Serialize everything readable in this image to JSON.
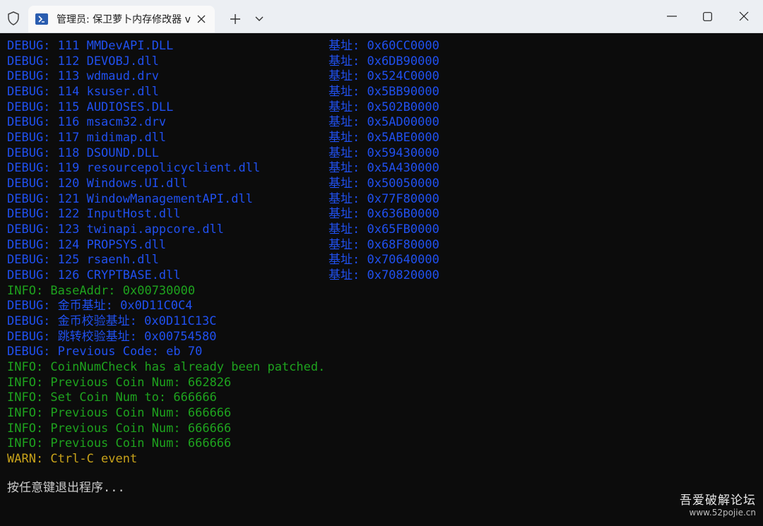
{
  "window": {
    "tab_title": "管理员: 保卫萝卜内存修改器 v",
    "new_tab_symbol": "+",
    "icons": [
      "shield-icon",
      "powershell-icon",
      "close-icon",
      "plus-icon",
      "chevron-down-icon",
      "minimize-icon",
      "maximize-icon",
      "close-window-icon"
    ]
  },
  "colors": {
    "debug": "#2050ef",
    "info": "#1ea31e",
    "warn": "#c7a21a",
    "prompt": "#cccccc",
    "background": "#0c0c0c"
  },
  "modules": [
    {
      "text": "DEBUG: 111 MMDevAPI.DLL",
      "addr": "基址: 0x60CC0000"
    },
    {
      "text": "DEBUG: 112 DEVOBJ.dll",
      "addr": "基址: 0x6DB90000"
    },
    {
      "text": "DEBUG: 113 wdmaud.drv",
      "addr": "基址: 0x524C0000"
    },
    {
      "text": "DEBUG: 114 ksuser.dll",
      "addr": "基址: 0x5BB90000"
    },
    {
      "text": "DEBUG: 115 AUDIOSES.DLL",
      "addr": "基址: 0x502B0000"
    },
    {
      "text": "DEBUG: 116 msacm32.drv",
      "addr": "基址: 0x5AD00000"
    },
    {
      "text": "DEBUG: 117 midimap.dll",
      "addr": "基址: 0x5ABE0000"
    },
    {
      "text": "DEBUG: 118 DSOUND.DLL",
      "addr": "基址: 0x59430000"
    },
    {
      "text": "DEBUG: 119 resourcepolicyclient.dll",
      "addr": "基址: 0x5A430000"
    },
    {
      "text": "DEBUG: 120 Windows.UI.dll",
      "addr": "基址: 0x50050000"
    },
    {
      "text": "DEBUG: 121 WindowManagementAPI.dll",
      "addr": "基址: 0x77F80000"
    },
    {
      "text": "DEBUG: 122 InputHost.dll",
      "addr": "基址: 0x636B0000"
    },
    {
      "text": "DEBUG: 123 twinapi.appcore.dll",
      "addr": "基址: 0x65FB0000"
    },
    {
      "text": "DEBUG: 124 PROPSYS.dll",
      "addr": "基址: 0x68F80000"
    },
    {
      "text": "DEBUG: 125 rsaenh.dll",
      "addr": "基址: 0x70640000"
    },
    {
      "text": "DEBUG: 126 CRYPTBASE.dll",
      "addr": "基址: 0x70820000"
    }
  ],
  "log": [
    {
      "level": "info",
      "text": "INFO: BaseAddr: 0x00730000"
    },
    {
      "level": "debug",
      "text": "DEBUG: 金币基址: 0x0D11C0C4"
    },
    {
      "level": "debug",
      "text": "DEBUG: 金币校验基址: 0x0D11C13C"
    },
    {
      "level": "debug",
      "text": "DEBUG: 跳转校验基址: 0x00754580"
    },
    {
      "level": "debug",
      "text": "DEBUG: Previous Code: eb 70"
    },
    {
      "level": "info",
      "text": "INFO: CoinNumCheck has already been patched."
    },
    {
      "level": "info",
      "text": "INFO: Previous Coin Num: 662826"
    },
    {
      "level": "info",
      "text": "INFO: Set Coin Num to: 666666"
    },
    {
      "level": "info",
      "text": "INFO: Previous Coin Num: 666666"
    },
    {
      "level": "info",
      "text": "INFO: Previous Coin Num: 666666"
    },
    {
      "level": "info",
      "text": "INFO: Previous Coin Num: 666666"
    },
    {
      "level": "warn",
      "text": "WARN: Ctrl-C event"
    }
  ],
  "prompt": "按任意键退出程序...",
  "watermark": {
    "title": "吾爱破解论坛",
    "url": "www.52pojie.cn"
  }
}
